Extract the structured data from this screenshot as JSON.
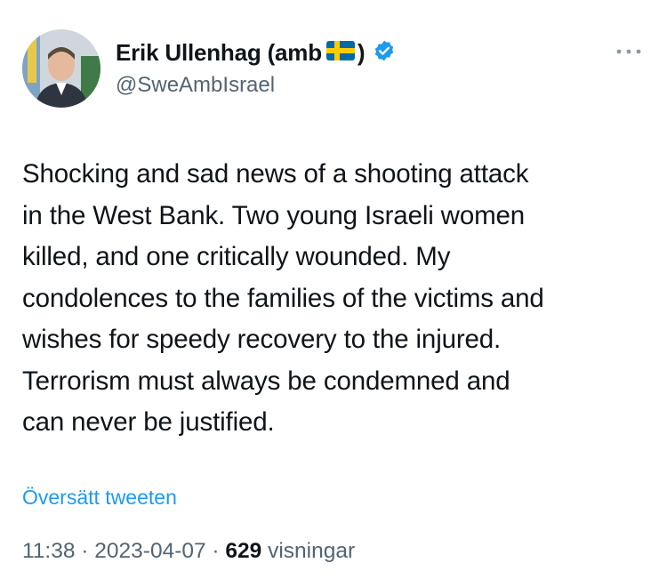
{
  "user": {
    "display_name": "Erik Ullenhag (amb",
    "display_name_close": ")",
    "handle": "@SweAmbIsrael",
    "flag_icon": "sweden-flag-icon",
    "verified_icon": "verified-badge-icon"
  },
  "tweet": {
    "text": "Shocking and sad news of a shooting attack\nin the West Bank. Two young Israeli women\nkilled, and one critically wounded. My\ncondolences to the families of the victims and\nwishes for speedy recovery to the injured.\nTerrorism must always be condemned and\ncan never be justified.",
    "translate_label": "Översätt tweeten",
    "time": "11:38",
    "sep1": " · ",
    "date": "2023-04-07",
    "sep2": " · ",
    "views_count": "629",
    "views_label": " visningar"
  },
  "colors": {
    "link_blue": "#1d9bf0",
    "secondary_text": "#536471",
    "primary_text": "#0f1419",
    "flag_blue": "#006aa7",
    "flag_yellow": "#fecc00"
  }
}
